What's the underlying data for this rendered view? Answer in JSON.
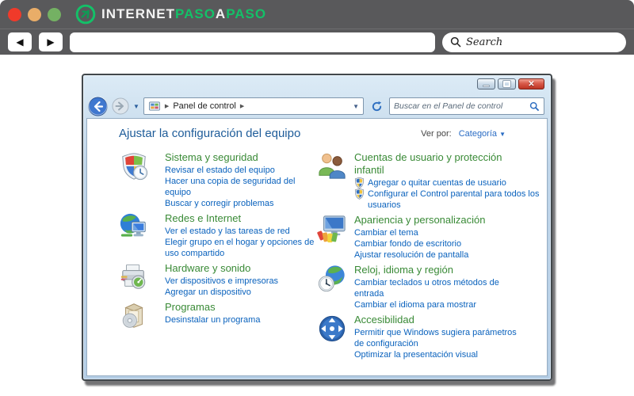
{
  "colors": {
    "chrome_gray": "#59595b",
    "brand_green": "#13c168",
    "dot_red": "#f03a2a",
    "dot_orange": "#e9ad68",
    "dot_green": "#74b163",
    "title_blue": "#1e5c99",
    "category_green": "#398a36",
    "link_blue": "#0a62bd"
  },
  "site_header": {
    "brand": {
      "segments": [
        {
          "text": "INTERNET"
        },
        {
          "text": "PASO"
        },
        {
          "text": "A"
        },
        {
          "text": "PASO"
        }
      ]
    }
  },
  "browser": {
    "back_glyph": "◀",
    "forward_glyph": "▶",
    "url_value": "",
    "search_placeholder": "Search"
  },
  "window": {
    "controls": [
      "minimize",
      "maximize",
      "close"
    ],
    "close_glyph": "✕",
    "address": {
      "location": "Panel de control"
    },
    "search_placeholder": "Buscar en el Panel de control",
    "page_title": "Ajustar la configuración del equipo",
    "view_by": {
      "label": "Ver por:",
      "value": "Categoría"
    },
    "columns": {
      "left": [
        {
          "icon": "system-security-icon",
          "title": "Sistema y seguridad",
          "links": [
            {
              "text": "Revisar el estado del equipo",
              "shield": false
            },
            {
              "text": "Hacer una copia de seguridad del equipo",
              "shield": false
            },
            {
              "text": "Buscar y corregir problemas",
              "shield": false
            }
          ]
        },
        {
          "icon": "network-internet-icon",
          "title": "Redes e Internet",
          "links": [
            {
              "text": "Ver el estado y las tareas de red",
              "shield": false
            },
            {
              "text": "Elegir grupo en el hogar y opciones de uso compartido",
              "shield": false
            }
          ]
        },
        {
          "icon": "hardware-sound-icon",
          "title": "Hardware y sonido",
          "links": [
            {
              "text": "Ver dispositivos e impresoras",
              "shield": false
            },
            {
              "text": "Agregar un dispositivo",
              "shield": false
            }
          ]
        },
        {
          "icon": "programs-icon",
          "title": "Programas",
          "links": [
            {
              "text": "Desinstalar un programa",
              "shield": false
            }
          ]
        }
      ],
      "right": [
        {
          "icon": "user-accounts-icon",
          "title": "Cuentas de usuario y protección infantil",
          "links": [
            {
              "text": "Agregar o quitar cuentas de usuario",
              "shield": true
            },
            {
              "text": "Configurar el Control parental para todos los usuarios",
              "shield": true
            }
          ]
        },
        {
          "icon": "appearance-icon",
          "title": "Apariencia y personalización",
          "links": [
            {
              "text": "Cambiar el tema",
              "shield": false
            },
            {
              "text": "Cambiar fondo de escritorio",
              "shield": false
            },
            {
              "text": "Ajustar resolución de pantalla",
              "shield": false
            }
          ]
        },
        {
          "icon": "clock-language-region-icon",
          "title": "Reloj, idioma y región",
          "links": [
            {
              "text": "Cambiar teclados u otros métodos de entrada",
              "shield": false
            },
            {
              "text": "Cambiar el idioma para mostrar",
              "shield": false
            }
          ]
        },
        {
          "icon": "ease-of-access-icon",
          "title": "Accesibilidad",
          "links": [
            {
              "text": "Permitir que Windows sugiera parámetros de configuración",
              "shield": false
            },
            {
              "text": "Optimizar la presentación visual",
              "shield": false
            }
          ]
        }
      ]
    }
  }
}
